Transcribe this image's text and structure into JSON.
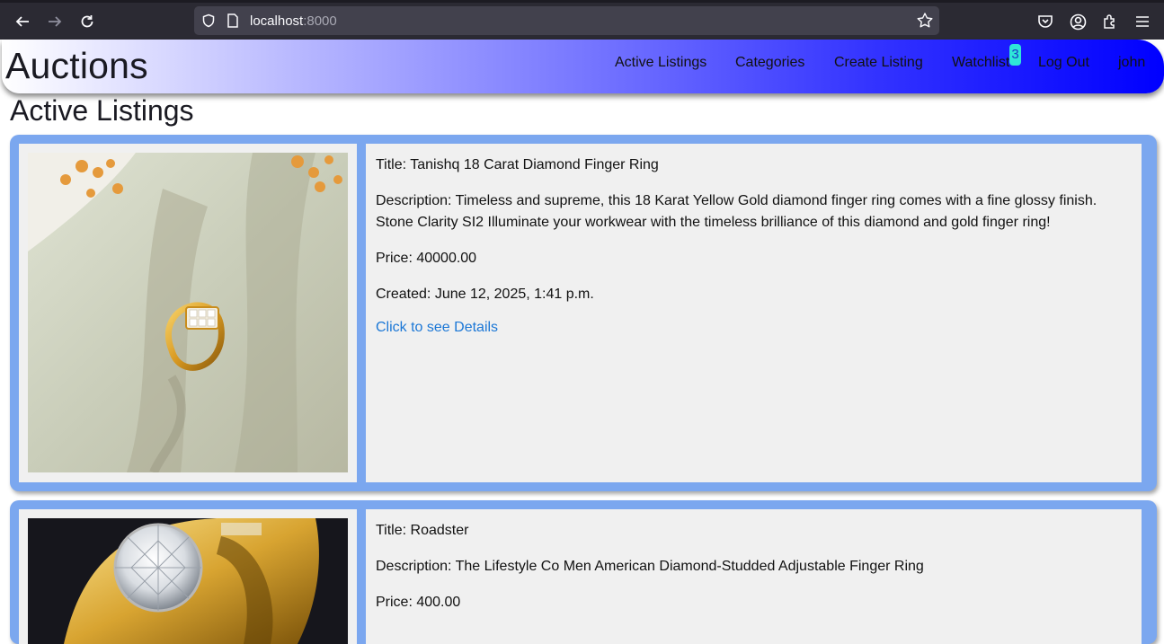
{
  "browser": {
    "url_host": "localhost",
    "url_port": ":8000"
  },
  "site": {
    "brand": "Auctions",
    "nav": {
      "active_listings": "Active Listings",
      "categories": "Categories",
      "create_listing": "Create Listing",
      "watchlist": "Watchlist",
      "watchlist_count": "3",
      "logout": "Log Out",
      "user": "john"
    }
  },
  "page": {
    "title": "Active Listings"
  },
  "listings": [
    {
      "title": "Title: Tanishq 18 Carat Diamond Finger Ring",
      "description": "Description: Timeless and supreme, this 18 Karat Yellow Gold diamond finger ring comes with a fine glossy finish. Stone Clarity SI2 Illuminate your workwear with the timeless brilliance of this diamond and gold finger ring!",
      "price": "Price: 40000.00",
      "created": "Created: June 12, 2025, 1:41 p.m.",
      "details_link": "Click to see Details"
    },
    {
      "title": "Title: Roadster",
      "description": "Description: The Lifestyle Co Men American Diamond-Studded Adjustable Finger Ring",
      "price": "Price: 400.00"
    }
  ],
  "colors": {
    "card_border": "#7ba7ef",
    "card_fill": "#f0f0f0",
    "link": "#1b77d6",
    "header_gradient_end": "#0000ff",
    "badge": "#2fe6d8"
  }
}
